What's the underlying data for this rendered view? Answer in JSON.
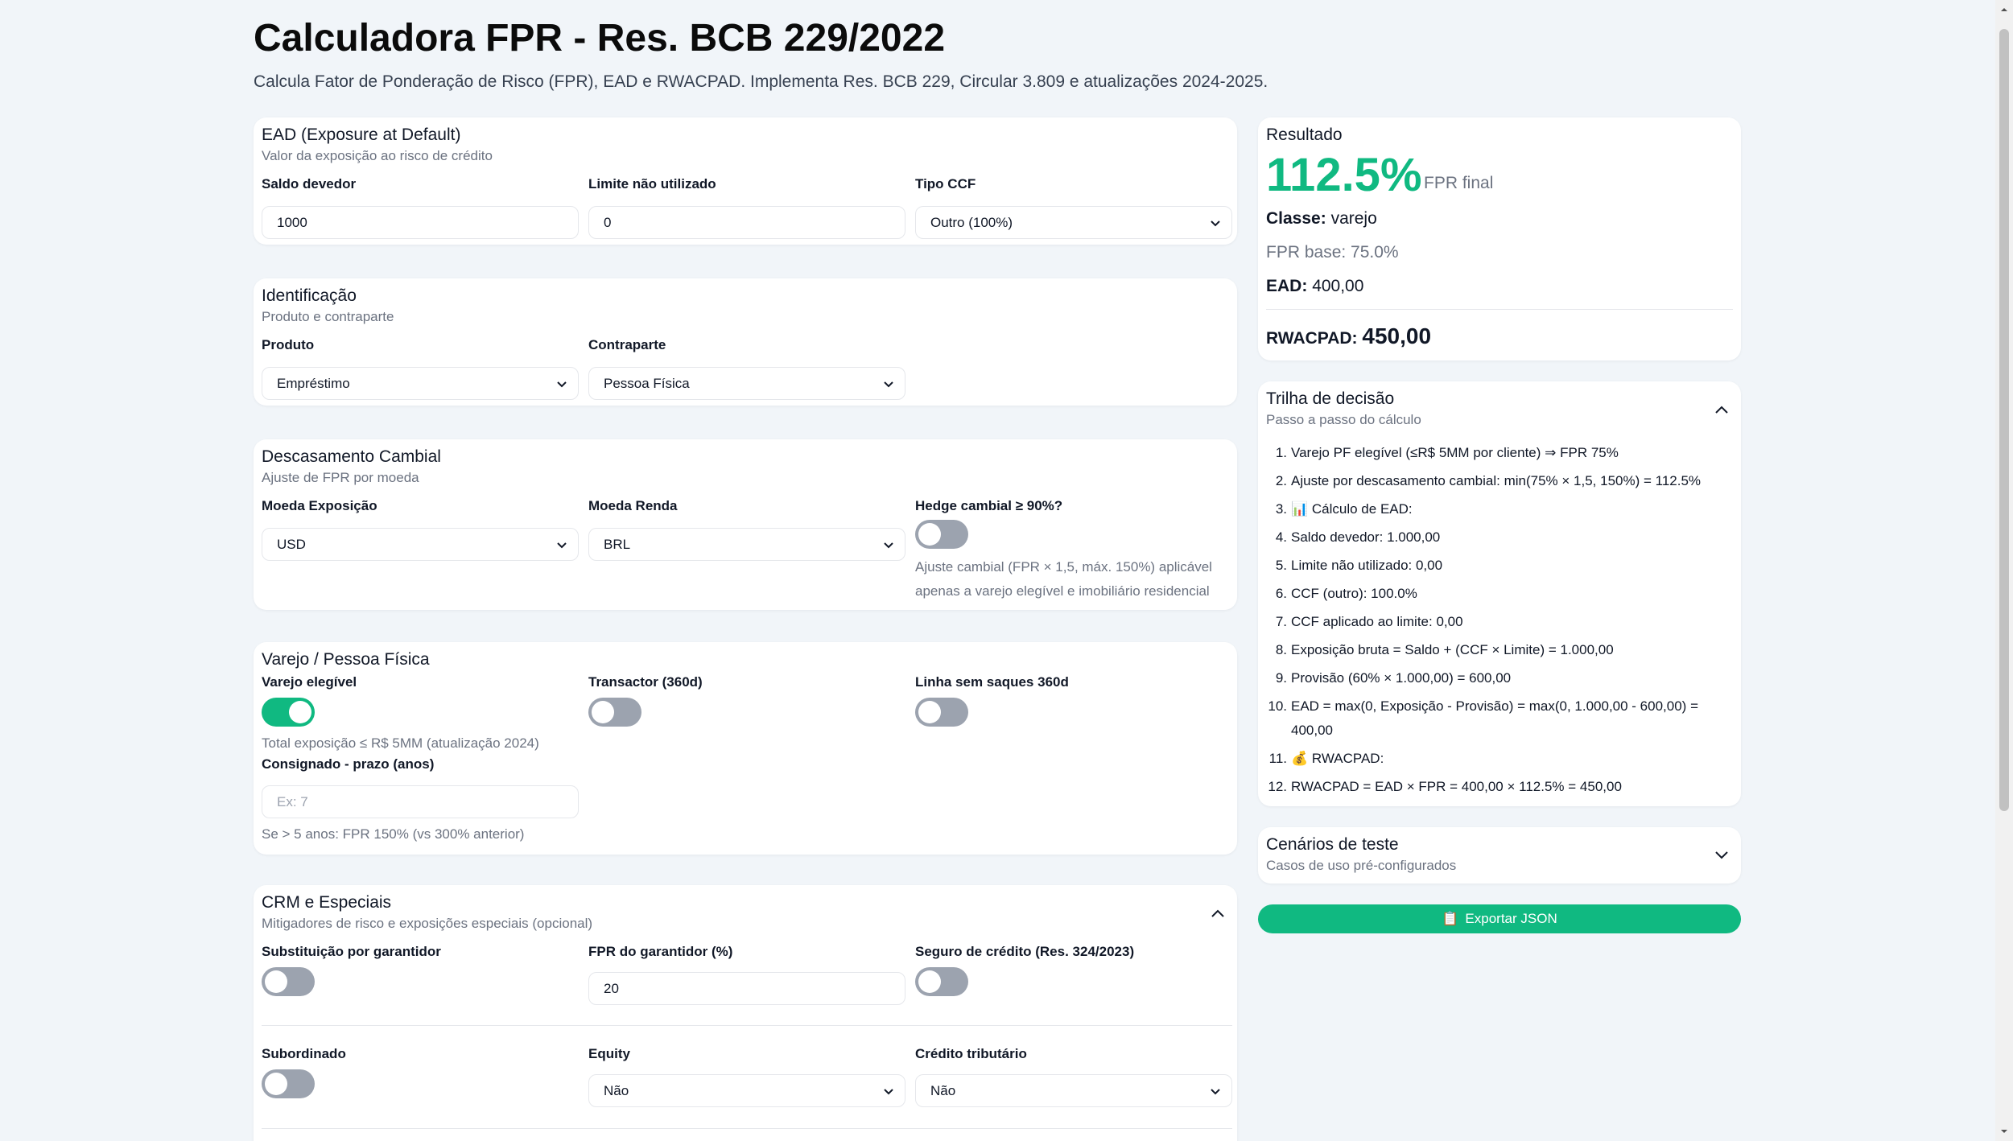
{
  "header": {
    "title": "Calculadora FPR - Res. BCB 229/2022",
    "subtitle": "Calcula Fator de Ponderação de Risco (FPR), EAD e RWACPAD. Implementa Res. BCB 229, Circular 3.809 e atualizações 2024-2025."
  },
  "ead": {
    "title": "EAD (Exposure at Default)",
    "subtitle": "Valor da exposição ao risco de crédito",
    "saldo_label": "Saldo devedor",
    "saldo_value": "1000",
    "limite_label": "Limite não utilizado",
    "limite_value": "0",
    "ccf_label": "Tipo CCF",
    "ccf_value": "Outro (100%)"
  },
  "identificacao": {
    "title": "Identificação",
    "subtitle": "Produto e contraparte",
    "produto_label": "Produto",
    "produto_value": "Empréstimo",
    "contraparte_label": "Contraparte",
    "contraparte_value": "Pessoa Física"
  },
  "cambial": {
    "title": "Descasamento Cambial",
    "subtitle": "Ajuste de FPR por moeda",
    "moeda_exp_label": "Moeda Exposição",
    "moeda_exp_value": "USD",
    "moeda_renda_label": "Moeda Renda",
    "moeda_renda_value": "BRL",
    "hedge_label": "Hedge cambial ≥ 90%?",
    "hedge_on": false,
    "hedge_hint_1": "Ajuste cambial (FPR × 1,5, máx. 150%) aplicável",
    "hedge_hint_2": "apenas a varejo elegível e imobiliário residencial"
  },
  "varejo": {
    "title": "Varejo / Pessoa Física",
    "elegivel_label": "Varejo elegível",
    "elegivel_on": true,
    "elegivel_hint": "Total exposição ≤ R$ 5MM (atualização 2024)",
    "transactor_label": "Transactor (360d)",
    "transactor_on": false,
    "linha_label": "Linha sem saques 360d",
    "linha_on": false,
    "consignado_label": "Consignado - prazo (anos)",
    "consignado_placeholder": "Ex: 7",
    "consignado_hint": "Se > 5 anos: FPR 150% (vs 300% anterior)"
  },
  "crm": {
    "title": "CRM e Especiais",
    "subtitle": "Mitigadores de risco e exposições especiais (opcional)",
    "garantidor_label": "Substituição por garantidor",
    "garantidor_on": false,
    "fpr_garantidor_label": "FPR do garantidor (%)",
    "fpr_garantidor_value": "20",
    "seguro_label": "Seguro de crédito (Res. 324/2023)",
    "seguro_on": false,
    "subordinado_label": "Subordinado",
    "subordinado_on": false,
    "equity_label": "Equity",
    "equity_value": "Não",
    "credito_label": "Crédito tributário",
    "credito_value": "Não"
  },
  "resultado": {
    "title": "Resultado",
    "fpr_value": "112.5%",
    "fpr_suffix": "FPR final",
    "classe_label": "Classe:",
    "classe_value": "varejo",
    "fpr_base": "FPR base: 75.0%",
    "ead_label": "EAD:",
    "ead_value": "400,00",
    "rwacpad_label": "RWACPAD:",
    "rwacpad_value": "450,00"
  },
  "trilha": {
    "title": "Trilha de decisão",
    "subtitle": "Passo a passo do cálculo",
    "steps": [
      "Varejo PF elegível (≤R$ 5MM por cliente) ⇒ FPR 75%",
      "Ajuste por descasamento cambial: min(75% × 1,5, 150%) = 112.5%",
      "📊 Cálculo de EAD:",
      "Saldo devedor: 1.000,00",
      "Limite não utilizado: 0,00",
      "CCF (outro): 100.0%",
      "CCF aplicado ao limite: 0,00",
      "Exposição bruta = Saldo + (CCF × Limite) = 1.000,00",
      "Provisão (60% × 1.000,00) = 600,00",
      "EAD = max(0, Exposição - Provisão) = max(0, 1.000,00 - 600,00) = 400,00",
      "💰 RWACPAD:",
      "RWACPAD = EAD × FPR = 400,00 × 112.5% = 450,00"
    ]
  },
  "cenarios": {
    "title": "Cenários de teste",
    "subtitle": "Casos de uso pré-configurados"
  },
  "export": {
    "icon": "📋",
    "label": "Exportar JSON"
  },
  "colors": {
    "accent": "#10b981",
    "background": "#f1f5f9",
    "muted_text": "#6b7280"
  }
}
